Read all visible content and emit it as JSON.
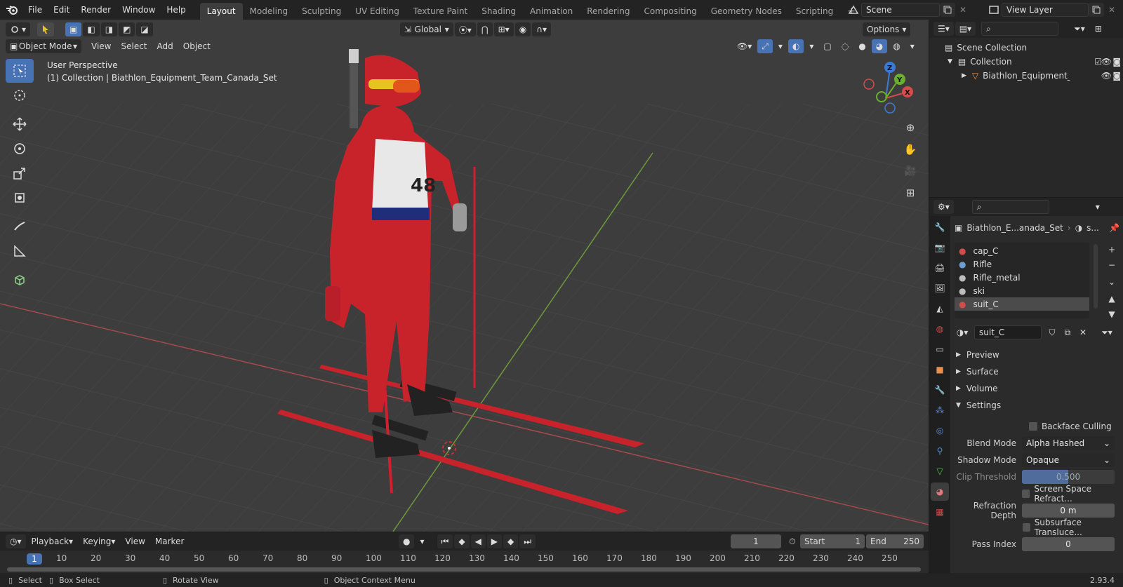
{
  "menu": [
    "File",
    "Edit",
    "Render",
    "Window",
    "Help"
  ],
  "workspaces": [
    "Layout",
    "Modeling",
    "Sculpting",
    "UV Editing",
    "Texture Paint",
    "Shading",
    "Animation",
    "Rendering",
    "Compositing",
    "Geometry Nodes",
    "Scripting"
  ],
  "active_workspace": "Layout",
  "scene": "Scene",
  "view_layer": "View Layer",
  "viewport": {
    "mode": "Object Mode",
    "menus": [
      "View",
      "Select",
      "Add",
      "Object"
    ],
    "orientation": "Global",
    "options_label": "Options",
    "info_line1": "User Perspective",
    "info_line2": "(1) Collection | Biathlon_Equipment_Team_Canada_Set",
    "gizmo_axes": [
      "Z",
      "Y",
      "X"
    ]
  },
  "timeline": {
    "menus": [
      "Playback",
      "Keying",
      "View",
      "Marker"
    ],
    "current_frame": "1",
    "start_label": "Start",
    "start": "1",
    "end_label": "End",
    "end": "250",
    "ticks": [
      "10",
      "20",
      "30",
      "40",
      "50",
      "60",
      "70",
      "80",
      "90",
      "100",
      "110",
      "120",
      "130",
      "140",
      "150",
      "160",
      "170",
      "180",
      "190",
      "200",
      "210",
      "220",
      "230",
      "240",
      "250"
    ],
    "ruler_current": "1"
  },
  "status": {
    "select": "Select",
    "box_select": "Box Select",
    "rotate_view": "Rotate View",
    "context_menu": "Object Context Menu",
    "version": "2.93.4"
  },
  "outliner": {
    "scene_collection": "Scene Collection",
    "collection": "Collection",
    "object": "Biathlon_Equipment_Tear"
  },
  "properties": {
    "breadcrumb_object": "Biathlon_E...anada_Set",
    "breadcrumb_material": "s...",
    "slots": [
      "cap_C",
      "Rifle",
      "Rifle_metal",
      "ski",
      "suit_C"
    ],
    "active_slot": "suit_C",
    "material_name": "suit_C",
    "panels": [
      "Preview",
      "Surface",
      "Volume",
      "Settings"
    ],
    "settings": {
      "backface_culling": "Backface Culling",
      "blend_mode_label": "Blend Mode",
      "blend_mode": "Alpha Hashed",
      "shadow_mode_label": "Shadow Mode",
      "shadow_mode": "Opaque",
      "clip_threshold_label": "Clip Threshold",
      "clip_threshold": "0.500",
      "ssr": "Screen Space Refract...",
      "refraction_depth_label": "Refraction Depth",
      "refraction_depth": "0 m",
      "subsurface": "Subsurface Transluce...",
      "pass_index_label": "Pass Index",
      "pass_index": "0"
    }
  }
}
